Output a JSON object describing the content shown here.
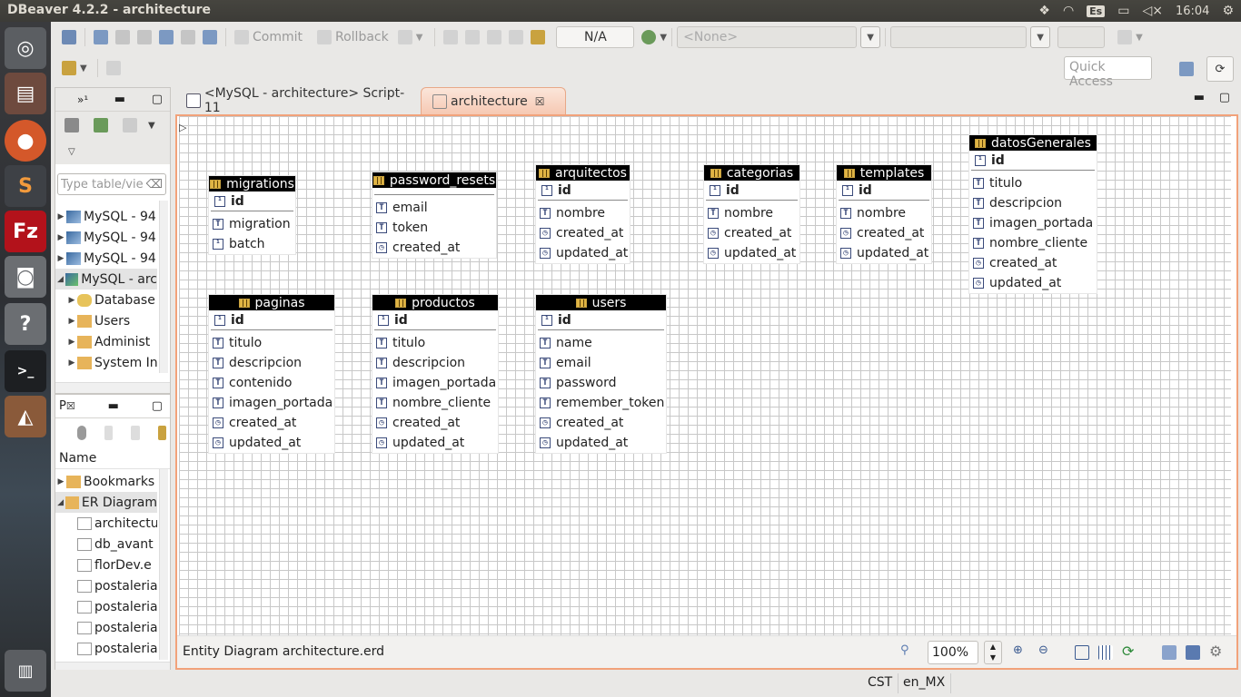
{
  "topbar": {
    "title": "DBeaver 4.2.2 - architecture",
    "keyboard": "Es",
    "time": "16:04"
  },
  "toolbar": {
    "commit": "Commit",
    "rollback": "Rollback",
    "txn_mode": "N/A",
    "schema_combo": "<None>",
    "quick_access": "Quick Access"
  },
  "navigator": {
    "items": [
      {
        "label": "MySQL - 94",
        "expanded": false
      },
      {
        "label": "MySQL - 94",
        "expanded": false
      },
      {
        "label": "MySQL - 94",
        "expanded": false
      },
      {
        "label": "MySQL - arc",
        "expanded": true
      },
      {
        "label": "Database",
        "expanded": false
      },
      {
        "label": "Users",
        "expanded": false
      },
      {
        "label": "Administ",
        "expanded": false
      },
      {
        "label": "System In",
        "expanded": false
      }
    ],
    "filter_placeholder": "Type table/vie"
  },
  "projects": {
    "tab_label": "P",
    "column_header": "Name",
    "items": [
      "Bookmarks",
      "ER Diagram",
      "architectu",
      "db_avant",
      "florDev.e",
      "postaleria",
      "postaleria",
      "postaleria",
      "postaleria"
    ]
  },
  "editor": {
    "tabs": [
      {
        "label": "<MySQL - architecture> Script-11",
        "active": false
      },
      {
        "label": "architecture",
        "active": true
      }
    ],
    "diagram_status": "Entity Diagram architecture.erd",
    "zoom": "100%"
  },
  "entities": [
    {
      "name": "migrations",
      "pk": "id",
      "columns": [
        {
          "name": "migration",
          "type": "text"
        },
        {
          "name": "batch",
          "type": "num"
        }
      ]
    },
    {
      "name": "password_resets",
      "pk": null,
      "columns": [
        {
          "name": "email",
          "type": "textkey"
        },
        {
          "name": "token",
          "type": "text"
        },
        {
          "name": "created_at",
          "type": "time"
        }
      ]
    },
    {
      "name": "arquitectos",
      "pk": "id",
      "columns": [
        {
          "name": "nombre",
          "type": "text"
        },
        {
          "name": "created_at",
          "type": "time"
        },
        {
          "name": "updated_at",
          "type": "time"
        }
      ]
    },
    {
      "name": "categorias",
      "pk": "id",
      "columns": [
        {
          "name": "nombre",
          "type": "text"
        },
        {
          "name": "created_at",
          "type": "time"
        },
        {
          "name": "updated_at",
          "type": "time"
        }
      ]
    },
    {
      "name": "templates",
      "pk": "id",
      "columns": [
        {
          "name": "nombre",
          "type": "text"
        },
        {
          "name": "created_at",
          "type": "time"
        },
        {
          "name": "updated_at",
          "type": "time"
        }
      ]
    },
    {
      "name": "datosGenerales",
      "pk": "id",
      "columns": [
        {
          "name": "titulo",
          "type": "text"
        },
        {
          "name": "descripcion",
          "type": "text"
        },
        {
          "name": "imagen_portada",
          "type": "text"
        },
        {
          "name": "nombre_cliente",
          "type": "text"
        },
        {
          "name": "created_at",
          "type": "time"
        },
        {
          "name": "updated_at",
          "type": "time"
        }
      ]
    },
    {
      "name": "paginas",
      "pk": "id",
      "columns": [
        {
          "name": "titulo",
          "type": "text"
        },
        {
          "name": "descripcion",
          "type": "text"
        },
        {
          "name": "contenido",
          "type": "text"
        },
        {
          "name": "imagen_portada",
          "type": "text"
        },
        {
          "name": "created_at",
          "type": "time"
        },
        {
          "name": "updated_at",
          "type": "time"
        }
      ]
    },
    {
      "name": "productos",
      "pk": "id",
      "columns": [
        {
          "name": "titulo",
          "type": "text"
        },
        {
          "name": "descripcion",
          "type": "text"
        },
        {
          "name": "imagen_portada",
          "type": "text"
        },
        {
          "name": "nombre_cliente",
          "type": "text"
        },
        {
          "name": "created_at",
          "type": "time"
        },
        {
          "name": "updated_at",
          "type": "time"
        }
      ]
    },
    {
      "name": "users",
      "pk": "id",
      "columns": [
        {
          "name": "name",
          "type": "text"
        },
        {
          "name": "email",
          "type": "textkey"
        },
        {
          "name": "password",
          "type": "text"
        },
        {
          "name": "remember_token",
          "type": "text"
        },
        {
          "name": "created_at",
          "type": "time"
        },
        {
          "name": "updated_at",
          "type": "time"
        }
      ]
    }
  ],
  "statusbar": {
    "timezone": "CST",
    "locale": "en_MX"
  },
  "colors": {
    "accent": "#f2a27a",
    "header": "#000000",
    "launcher_bg": "#2d2f33"
  }
}
